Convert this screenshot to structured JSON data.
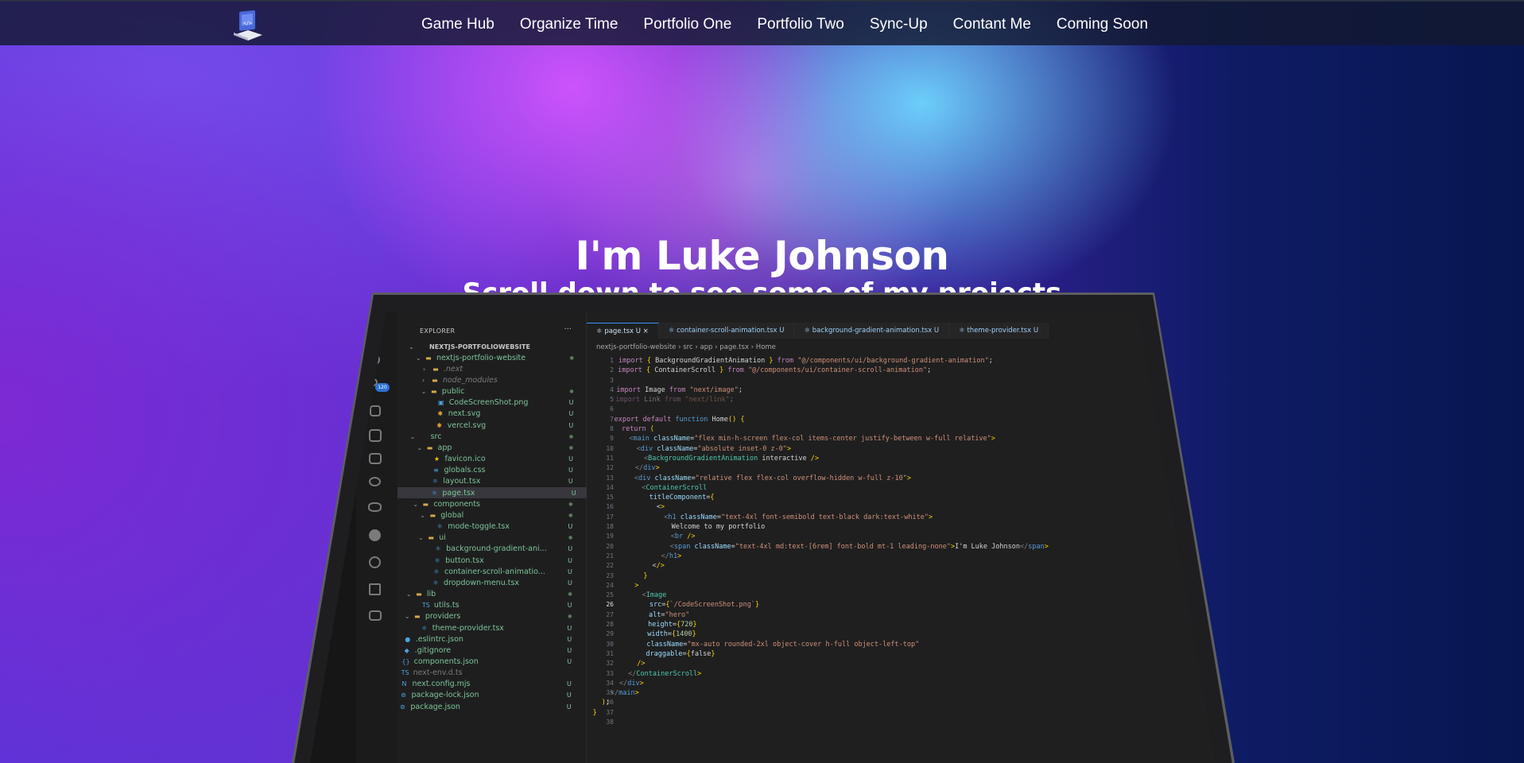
{
  "nav": {
    "links": [
      "Game Hub",
      "Organize Time",
      "Portfolio One",
      "Portfolio Two",
      "Sync-Up",
      "Contant Me",
      "Coming Soon"
    ]
  },
  "hero": {
    "title": "I'm Luke Johnson",
    "subtitle": "Scroll down to see some of my projects"
  },
  "editor": {
    "explorer_title": "EXPLORER",
    "explorer_menu": "···",
    "badge": "120",
    "tree": [
      {
        "label": "NEXTJS-PORTFOLIOWEBSITE",
        "chev": "⌄",
        "icon": "",
        "status": "",
        "indent": 0,
        "color": "#c8c8c8",
        "bold": true
      },
      {
        "label": "nextjs-portfolio-website",
        "chev": "⌄",
        "icon": "▬",
        "status": "●",
        "indent": 1,
        "color": "#7ec699"
      },
      {
        "label": ".next",
        "chev": "›",
        "icon": "▬",
        "status": "",
        "indent": 2,
        "color": "#7a7a7a",
        "italic": true
      },
      {
        "label": "node_modules",
        "chev": "›",
        "icon": "▬",
        "status": "",
        "indent": 2,
        "color": "#7a7a7a",
        "italic": true
      },
      {
        "label": "public",
        "chev": "⌄",
        "icon": "▬",
        "status": "●",
        "indent": 2,
        "color": "#7ec699"
      },
      {
        "label": "CodeScreenShot.png",
        "chev": "",
        "icon": "▣",
        "status": "U",
        "indent": 3,
        "color": "#7ec699"
      },
      {
        "label": "next.svg",
        "chev": "",
        "icon": "✱",
        "status": "U",
        "indent": 3,
        "color": "#7ec699"
      },
      {
        "label": "vercel.svg",
        "chev": "",
        "icon": "✱",
        "status": "U",
        "indent": 3,
        "color": "#7ec699"
      },
      {
        "label": "src",
        "chev": "⌄",
        "icon": "",
        "status": "●",
        "indent": 1,
        "color": "#7ec699"
      },
      {
        "label": "app",
        "chev": "⌄",
        "icon": "▬",
        "status": "●",
        "indent": 2,
        "color": "#7ec699"
      },
      {
        "label": "favicon.ico",
        "chev": "",
        "icon": "★",
        "status": "U",
        "indent": 3,
        "color": "#7ec699"
      },
      {
        "label": "globals.css",
        "chev": "",
        "icon": "≡",
        "status": "U",
        "indent": 3,
        "color": "#7ec699"
      },
      {
        "label": "layout.tsx",
        "chev": "",
        "icon": "⚛",
        "status": "U",
        "indent": 3,
        "color": "#7ec699"
      },
      {
        "label": "page.tsx",
        "chev": "",
        "icon": "⚛",
        "status": "U",
        "indent": 3,
        "color": "#7ec699",
        "selected": true
      },
      {
        "label": "components",
        "chev": "⌄",
        "icon": "▬",
        "status": "●",
        "indent": 2,
        "color": "#7ec699"
      },
      {
        "label": "global",
        "chev": "⌄",
        "icon": "▬",
        "status": "●",
        "indent": 3,
        "color": "#7ec699"
      },
      {
        "label": "mode-toggle.tsx",
        "chev": "",
        "icon": "⚛",
        "status": "U",
        "indent": 4,
        "color": "#7ec699"
      },
      {
        "label": "ui",
        "chev": "⌄",
        "icon": "▬",
        "status": "●",
        "indent": 3,
        "color": "#7ec699"
      },
      {
        "label": "background-gradient-ani...",
        "chev": "",
        "icon": "⚛",
        "status": "U",
        "indent": 4,
        "color": "#7ec699"
      },
      {
        "label": "button.tsx",
        "chev": "",
        "icon": "⚛",
        "status": "U",
        "indent": 4,
        "color": "#7ec699"
      },
      {
        "label": "container-scroll-animatio...",
        "chev": "",
        "icon": "⚛",
        "status": "U",
        "indent": 4,
        "color": "#7ec699"
      },
      {
        "label": "dropdown-menu.tsx",
        "chev": "",
        "icon": "⚛",
        "status": "U",
        "indent": 4,
        "color": "#7ec699"
      },
      {
        "label": "lib",
        "chev": "⌄",
        "icon": "▬",
        "status": "●",
        "indent": 2,
        "color": "#7ec699"
      },
      {
        "label": "utils.ts",
        "chev": "",
        "icon": "TS",
        "status": "U",
        "indent": 3,
        "color": "#7ec699"
      },
      {
        "label": "providers",
        "chev": "⌄",
        "icon": "▬",
        "status": "●",
        "indent": 2,
        "color": "#7ec699"
      },
      {
        "label": "theme-provider.tsx",
        "chev": "",
        "icon": "⚛",
        "status": "U",
        "indent": 3,
        "color": "#7ec699"
      },
      {
        "label": ".eslintrc.json",
        "chev": "",
        "icon": "●",
        "status": "U",
        "indent": 1,
        "color": "#7ec699"
      },
      {
        "label": ".gitignore",
        "chev": "",
        "icon": "◆",
        "status": "U",
        "indent": 1,
        "color": "#7ec699"
      },
      {
        "label": "components.json",
        "chev": "",
        "icon": "{}",
        "status": "U",
        "indent": 1,
        "color": "#7ec699"
      },
      {
        "label": "next-env.d.ts",
        "chev": "",
        "icon": "TS",
        "status": "",
        "indent": 1,
        "color": "#7a7a7a"
      },
      {
        "label": "next.config.mjs",
        "chev": "",
        "icon": "N",
        "status": "U",
        "indent": 1,
        "color": "#7ec699"
      },
      {
        "label": "package-lock.json",
        "chev": "",
        "icon": "⊚",
        "status": "U",
        "indent": 1,
        "color": "#7ec699"
      },
      {
        "label": "package.json",
        "chev": "",
        "icon": "⊚",
        "status": "U",
        "indent": 1,
        "color": "#7ec699"
      }
    ],
    "tabs": [
      {
        "label": "page.tsx",
        "status": "U",
        "active": true
      },
      {
        "label": "container-scroll-animation.tsx",
        "status": "U"
      },
      {
        "label": "background-gradient-animation.tsx",
        "status": "U"
      },
      {
        "label": "theme-provider.tsx",
        "status": "U"
      }
    ],
    "breadcrumb": [
      "nextjs-portfolio-website",
      "src",
      "app",
      "page.tsx",
      "Home"
    ],
    "current_line": 26,
    "code_lines": [
      "import { BackgroundGradientAnimation } from \"@/components/ui/background-gradient-animation\";",
      "import { ContainerScroll } from \"@/components/ui/container-scroll-animation\";",
      "",
      "import Image from \"next/image\";",
      "import Link from \"next/link\";",
      "",
      "export default function Home() {",
      "  return (",
      "    <main className=\"flex min-h-screen flex-col items-center justify-between w-full relative\">",
      "      <div className=\"absolute inset-0 z-0\">",
      "        <BackgroundGradientAnimation interactive />",
      "      </div>",
      "      <div className=\"relative flex flex-col overflow-hidden w-full z-10\">",
      "        <ContainerScroll",
      "          titleComponent={",
      "            <>",
      "              <h1 className=\"text-4xl font-semibold text-black dark:text-white\">",
      "                Welcome to my portfolio",
      "                <br />",
      "                <span className=\"text-4xl md:text-[6rem] font-bold mt-1 leading-none\">I'm Luke Johnson</span>",
      "              </h1>",
      "            </>",
      "          }",
      "        >",
      "          <Image",
      "            src={`/CodeScreenShot.png`}",
      "            alt=\"hero\"",
      "            height={720}",
      "            width={1400}",
      "            className=\"mx-auto rounded-2xl object-cover h-full object-left-top\"",
      "            draggable={false}",
      "          />",
      "        </ContainerScroll>",
      "      </div>",
      "    </main>",
      "  );",
      "}",
      ""
    ]
  }
}
